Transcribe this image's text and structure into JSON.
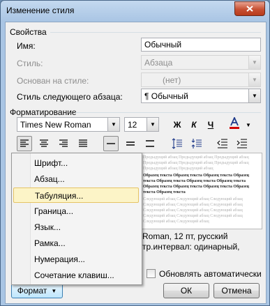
{
  "window": {
    "title": "Изменение стиля"
  },
  "properties": {
    "section_title": "Свойства",
    "name_label": "Имя:",
    "name_value": "Обычный",
    "style_label": "Стиль:",
    "style_value": "Абзаца",
    "based_on_label": "Основан на стиле:",
    "based_on_value": "(нет)",
    "next_style_label": "Стиль следующего абзаца:",
    "next_style_value": "¶ Обычный"
  },
  "formatting": {
    "section_title": "Форматирование",
    "font_value": "Times New Roman",
    "size_value": "12",
    "bold_label": "Ж",
    "italic_label": "К",
    "underline_label": "Ч",
    "font_color": "#d00000"
  },
  "preview": {
    "gray_text": "Предыдущий абзац Предыдущий абзац Предыдущий абзац Предыдущий абзац Предыдущий абзац Предыдущий абзац Предыдущий абзац Предыдущий абзац",
    "sample_text": "Образец текста Образец текста Образец текста Образец текста Образец текста Образец текста Образец текста Образец текста Образец текста Образец текста Образец текста Образец текста",
    "next_text": "Следующий абзац Следующий абзац Следующий абзац Следующий абзац Следующий абзац Следующий абзац Следующий абзац Следующий абзац Следующий абзац Следующий абзац Следующий абзац Следующий абзац Следующий абзац Следующий абзац"
  },
  "description": {
    "line1": "Roman, 12 пт, русский",
    "line2": "тр.интервал:  одинарный,"
  },
  "auto_update_label": "Обновлять автоматически",
  "buttons": {
    "format": "Формат",
    "ok": "ОК",
    "cancel": "Отмена"
  },
  "menu": {
    "items": [
      {
        "label": "Шрифт..."
      },
      {
        "label": "Абзац..."
      },
      {
        "label": "Табуляция..."
      },
      {
        "label": "Граница..."
      },
      {
        "label": "Язык..."
      },
      {
        "label": "Рамка..."
      },
      {
        "label": "Нумерация..."
      },
      {
        "label": "Сочетание клавиш..."
      }
    ],
    "highlighted_index": 2
  }
}
